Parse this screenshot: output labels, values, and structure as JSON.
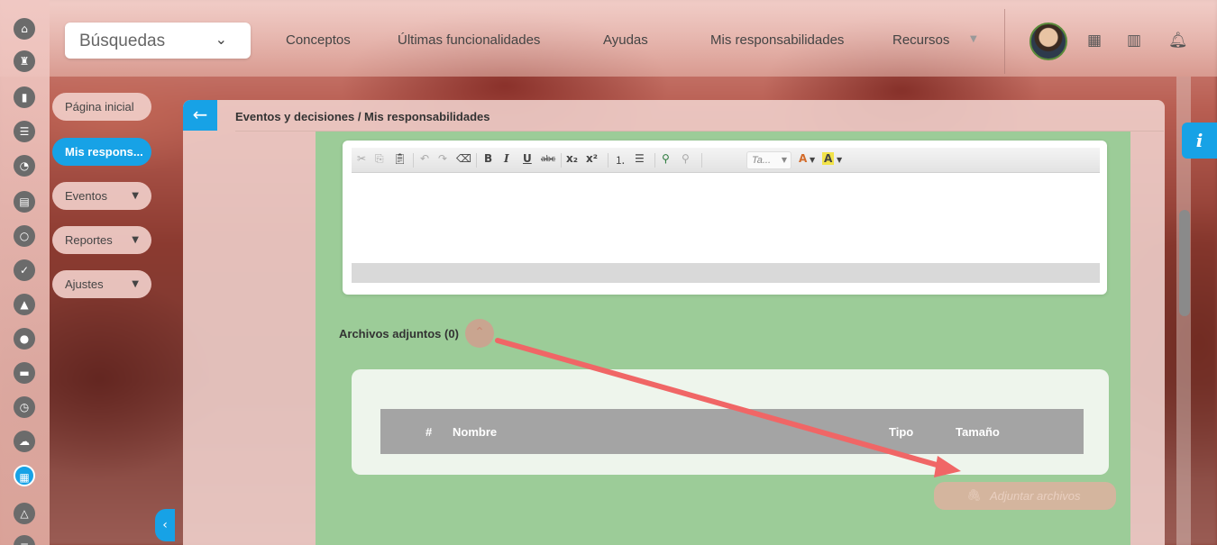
{
  "search": {
    "label": "Búsquedas"
  },
  "nav": {
    "links": [
      "Conceptos",
      "Últimas funcionalidades",
      "Ayudas",
      "Mis responsabilidades",
      "Recursos"
    ]
  },
  "icons": {
    "rail": [
      "home-icon",
      "chess-rook-icon",
      "bar-chart-icon",
      "menu-lines-icon",
      "pie-chart-icon",
      "document-icon",
      "refresh-circle-icon",
      "check-circle-icon",
      "warning-icon",
      "toggle-icon",
      "presentation-icon",
      "clock-icon",
      "cloud-icon",
      "calendar-icon",
      "triangle-nodes-icon",
      "list-icon"
    ],
    "top": [
      "calendar-grid-icon",
      "books-icon",
      "bell-icon"
    ]
  },
  "sidebar": {
    "items": [
      {
        "label": "Página inicial",
        "active": false
      },
      {
        "label": "Mis respons...",
        "active": true
      },
      {
        "label": "Eventos",
        "active": false
      },
      {
        "label": "Reportes",
        "active": false
      },
      {
        "label": "Ajustes",
        "active": false
      }
    ]
  },
  "panel": {
    "title": "Eventos y decisiones / Mis responsabilidades"
  },
  "editor": {
    "toolbar": {
      "combo_placeholder": "Ta...",
      "bold": "B",
      "italic": "I",
      "underline": "U",
      "strike": "abc",
      "subscript": "x₂",
      "superscript": "x²",
      "text_color": "A",
      "bg_color": "A"
    }
  },
  "attachments": {
    "label": "Archivos adjuntos (0)",
    "columns": [
      "#",
      "Nombre",
      "Tipo",
      "Tamaño"
    ],
    "rows": [],
    "button_label": "Adjuntar archivos"
  },
  "info": {
    "label": "i"
  },
  "colors": {
    "accent": "#17a2e6",
    "section_bg": "#9ccc98",
    "annotation_arrow": "#f06666"
  }
}
